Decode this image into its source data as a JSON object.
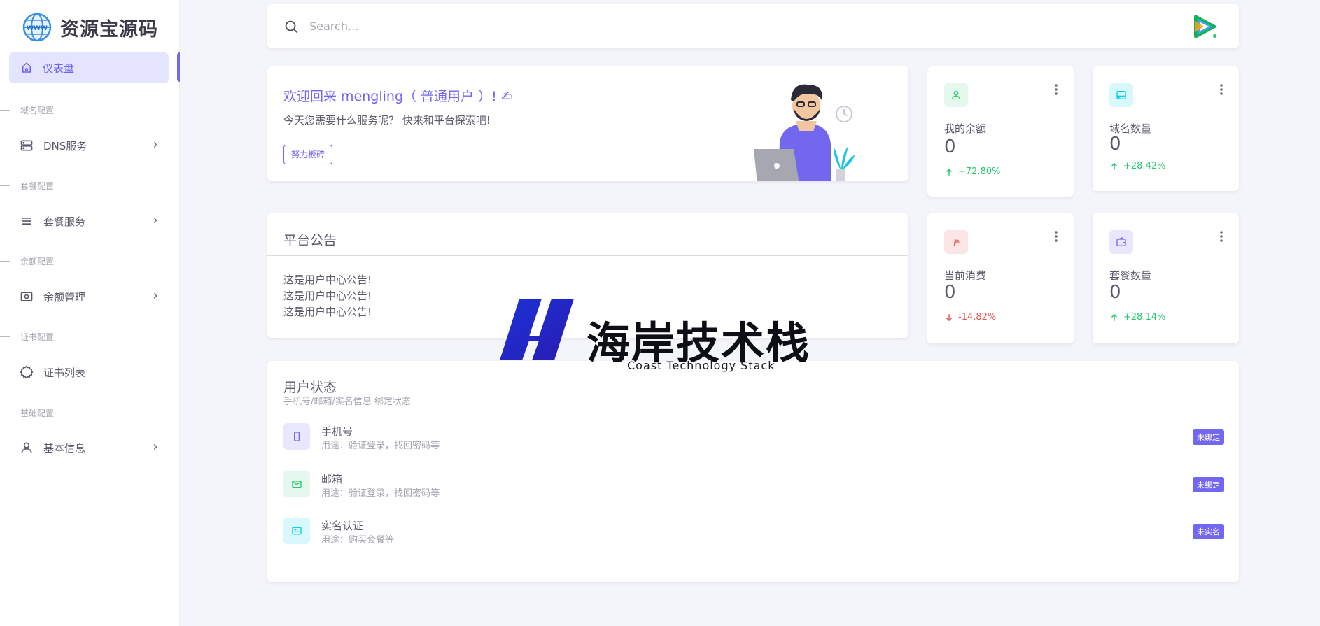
{
  "brand": {
    "name": "资源宝源码"
  },
  "sidebar": {
    "active": {
      "label": "仪表盘",
      "icon": "home-icon"
    },
    "sections": [
      {
        "title": "域名配置",
        "item": {
          "label": "DNS服务",
          "icon": "server-icon"
        }
      },
      {
        "title": "套餐配置",
        "item": {
          "label": "套餐服务",
          "icon": "list-icon"
        }
      },
      {
        "title": "余额配置",
        "item": {
          "label": "余额管理",
          "icon": "cash-icon"
        }
      },
      {
        "title": "证书配置",
        "item": {
          "label": "证书列表",
          "icon": "cert-icon"
        }
      },
      {
        "title": "基础配置",
        "item": {
          "label": "基本信息",
          "icon": "user-icon"
        }
      }
    ]
  },
  "search": {
    "placeholder": "Search..."
  },
  "welcome": {
    "title": "欢迎回来 mengling（ 普通用户 ）! ✍",
    "subtitle": "今天您需要什么服务呢？ 快来和平台探索吧!",
    "button": "努力板砖"
  },
  "stats": [
    {
      "label": "我的余额",
      "value": "0",
      "change": "+72.80%",
      "direction": "up",
      "icon": "user-icon",
      "color": "#28c76f"
    },
    {
      "label": "域名数量",
      "value": "0",
      "change": "+28.42%",
      "direction": "up",
      "icon": "drive-icon",
      "color": "#00cfe8"
    },
    {
      "label": "当前消费",
      "value": "0",
      "change": "-14.82%",
      "direction": "down",
      "icon": "paypal-icon",
      "color": "#ea5455"
    },
    {
      "label": "套餐数量",
      "value": "0",
      "change": "+28.14%",
      "direction": "up",
      "icon": "wallet-icon",
      "color": "#7367f0"
    }
  ],
  "notice": {
    "title": "平台公告",
    "lines": [
      "这是用户中心公告!",
      "这是用户中心公告!",
      "这是用户中心公告!"
    ]
  },
  "user_status": {
    "title": "用户状态",
    "subtitle": "手机号/邮箱/实名信息 绑定状态",
    "rows": [
      {
        "name": "手机号",
        "use": "用途：验证登录，找回密码等",
        "badge": "未绑定",
        "icon": "phone-icon",
        "color": "#7367f0"
      },
      {
        "name": "邮箱",
        "use": "用途：验证登录，找回密码等",
        "badge": "未绑定",
        "icon": "mail-icon",
        "color": "#28c76f"
      },
      {
        "name": "实名认证",
        "use": "用途：购买套餐等",
        "badge": "未实名",
        "icon": "id-card-icon",
        "color": "#00cfe8"
      }
    ]
  },
  "watermark": {
    "text": "海岸技术栈",
    "subtitle": "Coast Technology Stack"
  }
}
